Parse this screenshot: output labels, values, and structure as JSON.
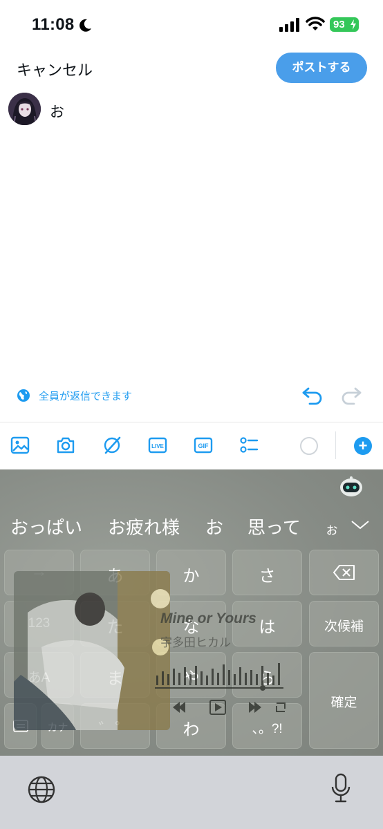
{
  "status_bar": {
    "time": "11:08",
    "battery": "93"
  },
  "header": {
    "cancel_label": "キャンセル",
    "post_label": "ポストする"
  },
  "compose": {
    "text": "お"
  },
  "reply_setting": {
    "label": "全員が返信できます"
  },
  "toolbar": {
    "icons": [
      "image-icon",
      "camera-icon",
      "grok-icon",
      "live-icon",
      "gif-icon",
      "poll-icon"
    ],
    "live_label": "LIVE",
    "gif_label": "GIF",
    "add_label": "+"
  },
  "keyboard": {
    "candidates": [
      "おっぱい",
      "お疲れ様",
      "お",
      "思って",
      "ぉ"
    ],
    "keys": {
      "arrow": "→",
      "a": "あ",
      "ka": "か",
      "sa": "さ",
      "num": "123",
      "ta": "た",
      "na": "な",
      "ha": "は",
      "next_candidate": "次候補",
      "mode": "あA",
      "ma": "ま",
      "ya": "や",
      "ra": "ら",
      "confirm": "確定",
      "kana": "カナ",
      "dakuten": "゛゜",
      "wa": "わ",
      "punct": "、。?!"
    }
  },
  "music_widget": {
    "title": "Mine or Yours",
    "artist": "宇多田ヒカル"
  },
  "colors": {
    "accent": "#1d9bf0",
    "post_button": "#4a9eea",
    "battery": "#34c759"
  }
}
